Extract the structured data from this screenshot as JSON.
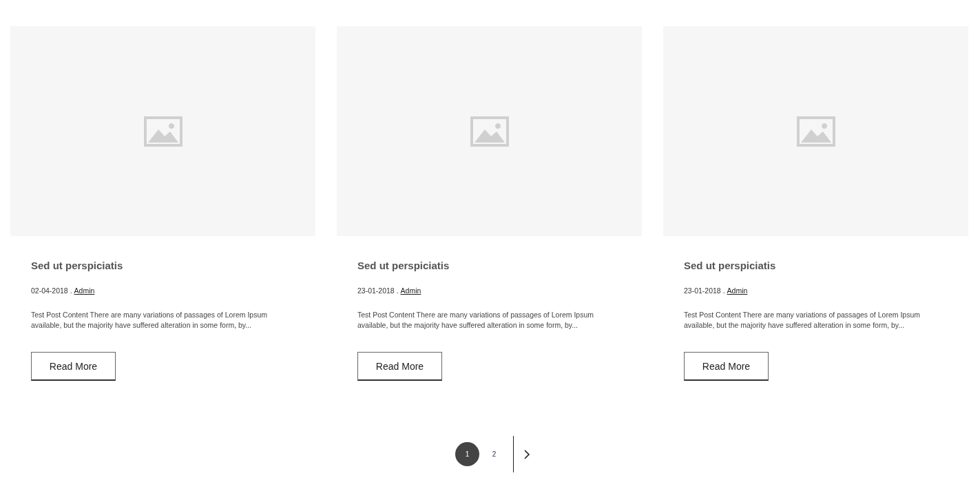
{
  "posts": [
    {
      "title": "Sed ut perspiciatis",
      "date": "02-04-2018",
      "separator": ".",
      "author": "Admin",
      "excerpt": "Test Post Content There are many variations of passages of Lorem Ipsum available, but the majority have suffered alteration in some form, by...",
      "button": "Read More"
    },
    {
      "title": "Sed ut perspiciatis",
      "date": "23-01-2018",
      "separator": ".",
      "author": "Admin",
      "excerpt": "Test Post Content There are many variations of passages of Lorem Ipsum available, but the majority have suffered alteration in some form, by...",
      "button": "Read More"
    },
    {
      "title": "Sed ut perspiciatis",
      "date": "23-01-2018",
      "separator": ".",
      "author": "Admin",
      "excerpt": "Test Post Content There are many variations of passages of Lorem Ipsum available, but the majority have suffered alteration in some form, by...",
      "button": "Read More"
    }
  ],
  "pagination": {
    "pages": [
      {
        "label": "1",
        "selected": true
      },
      {
        "label": "2",
        "selected": false
      }
    ]
  }
}
